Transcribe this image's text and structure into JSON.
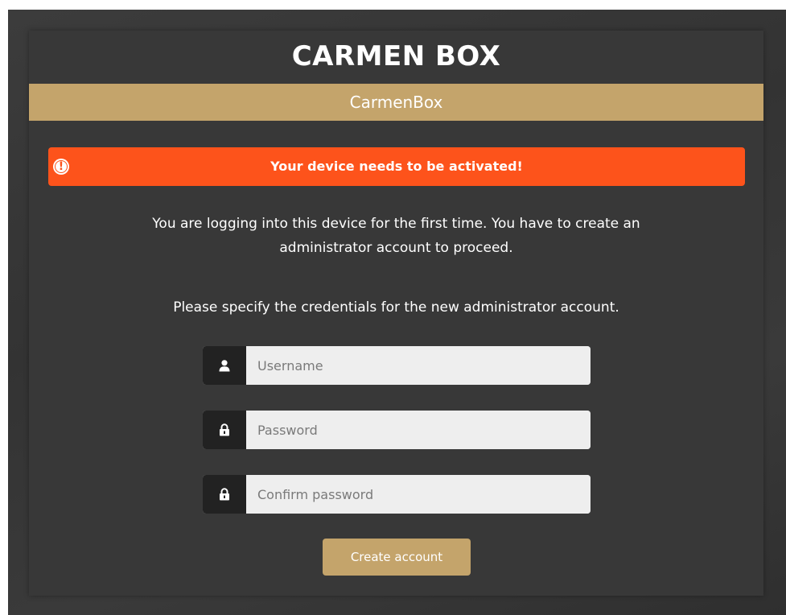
{
  "header": {
    "brand_title": "CARMEN BOX",
    "subtitle": "CarmenBox"
  },
  "alert": {
    "icon": "exclamation-circle-icon",
    "message": "Your device needs to be activated!"
  },
  "intro": {
    "line1": "You are logging into this device for the first time. You have to create an",
    "line2": "administrator account to proceed.",
    "instruction": "Please specify the credentials for the new administrator account."
  },
  "form": {
    "username": {
      "placeholder": "Username",
      "value": "",
      "icon": "user-icon"
    },
    "password": {
      "placeholder": "Password",
      "value": "",
      "icon": "lock-icon"
    },
    "confirm_password": {
      "placeholder": "Confirm password",
      "value": "",
      "icon": "lock-icon"
    },
    "submit_label": "Create account"
  },
  "colors": {
    "accent_gold": "#c4a46b",
    "alert_orange": "#fd531b",
    "panel_bg": "#383838",
    "addon_bg": "#222222",
    "input_bg": "#eeeeee"
  }
}
